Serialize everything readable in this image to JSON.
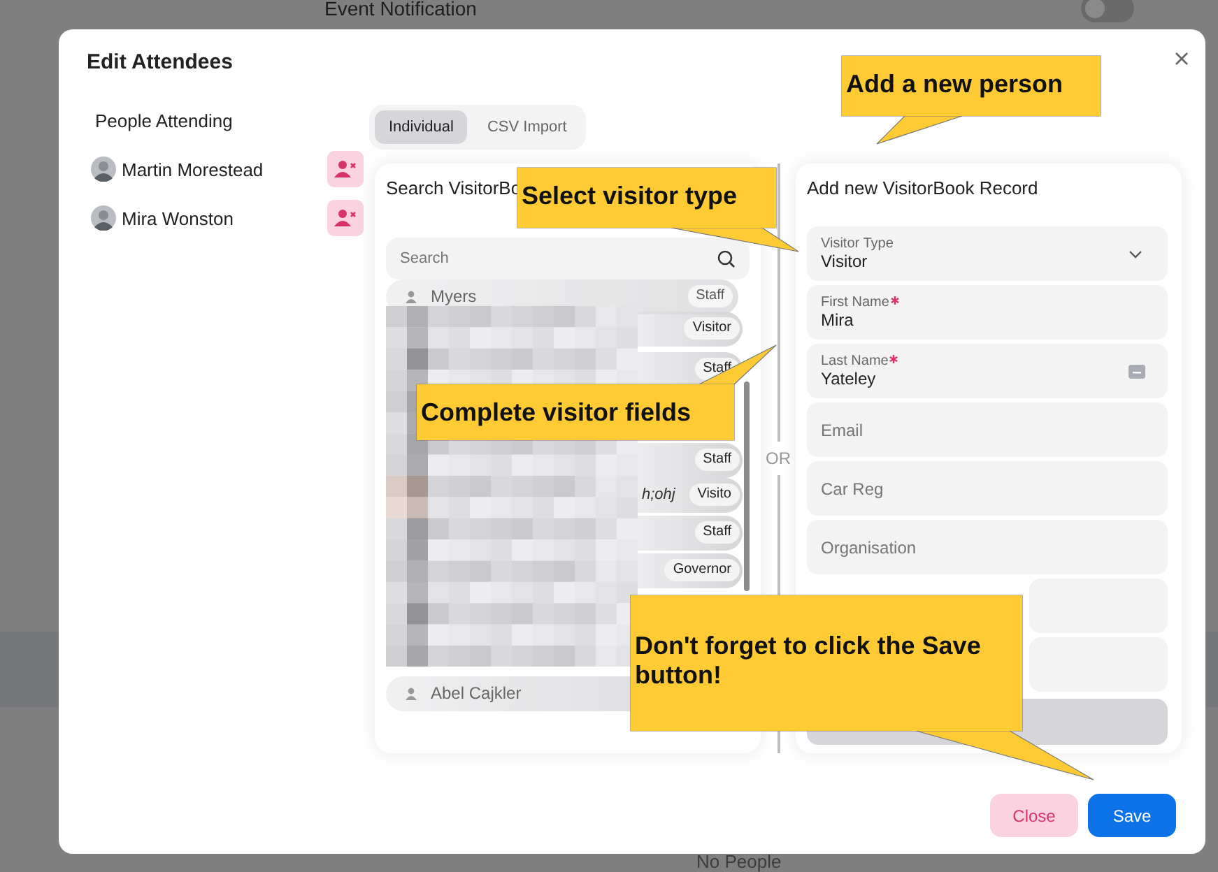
{
  "background": {
    "title": "Event Notification",
    "toggle": {
      "on": false
    },
    "footer_text": "No People"
  },
  "dialog": {
    "title": "Edit Attendees",
    "attendees_heading": "People Attending",
    "attendees": [
      {
        "name": "Martin Morestead"
      },
      {
        "name": "Mira Wonston"
      }
    ],
    "tabs": [
      {
        "label": "Individual",
        "selected": true
      },
      {
        "label": "CSV Import",
        "selected": false
      }
    ],
    "search_panel": {
      "title": "Search VisitorBo",
      "search": {
        "placeholder": "Search"
      },
      "results": [
        {
          "name": "Myers",
          "tag": "Staff"
        },
        {
          "tag": "Visitor"
        },
        {
          "tag": "Staff"
        },
        {
          "tag": "Staff"
        },
        {
          "name": "h;ohj",
          "tag": "Visito"
        },
        {
          "tag": "Staff"
        },
        {
          "tag": "Governor"
        },
        {
          "name": "Abel Cajkler"
        }
      ]
    },
    "divider_label": "OR",
    "form": {
      "title": "Add new VisitorBook Record",
      "fields": [
        {
          "kind": "select",
          "label": "Visitor Type",
          "value": "Visitor"
        },
        {
          "kind": "text",
          "label": "First Name",
          "required": true,
          "value": "Mira"
        },
        {
          "kind": "lookup",
          "label": "Last Name",
          "required": true,
          "value": "Yateley"
        },
        {
          "kind": "text",
          "placeholder": "Email"
        },
        {
          "kind": "text",
          "placeholder": "Car Reg"
        },
        {
          "kind": "text",
          "placeholder": "Organisation"
        },
        {
          "kind": "text"
        },
        {
          "kind": "text"
        }
      ]
    },
    "buttons": [
      {
        "kind": "close",
        "label": "Close"
      },
      {
        "kind": "save",
        "label": "Save"
      }
    ]
  },
  "callouts": [
    {
      "text": "Add a new person"
    },
    {
      "text": "Select visitor type"
    },
    {
      "text": "Complete visitor fields"
    },
    {
      "text": "Don't forget to click the Save button!"
    }
  ]
}
